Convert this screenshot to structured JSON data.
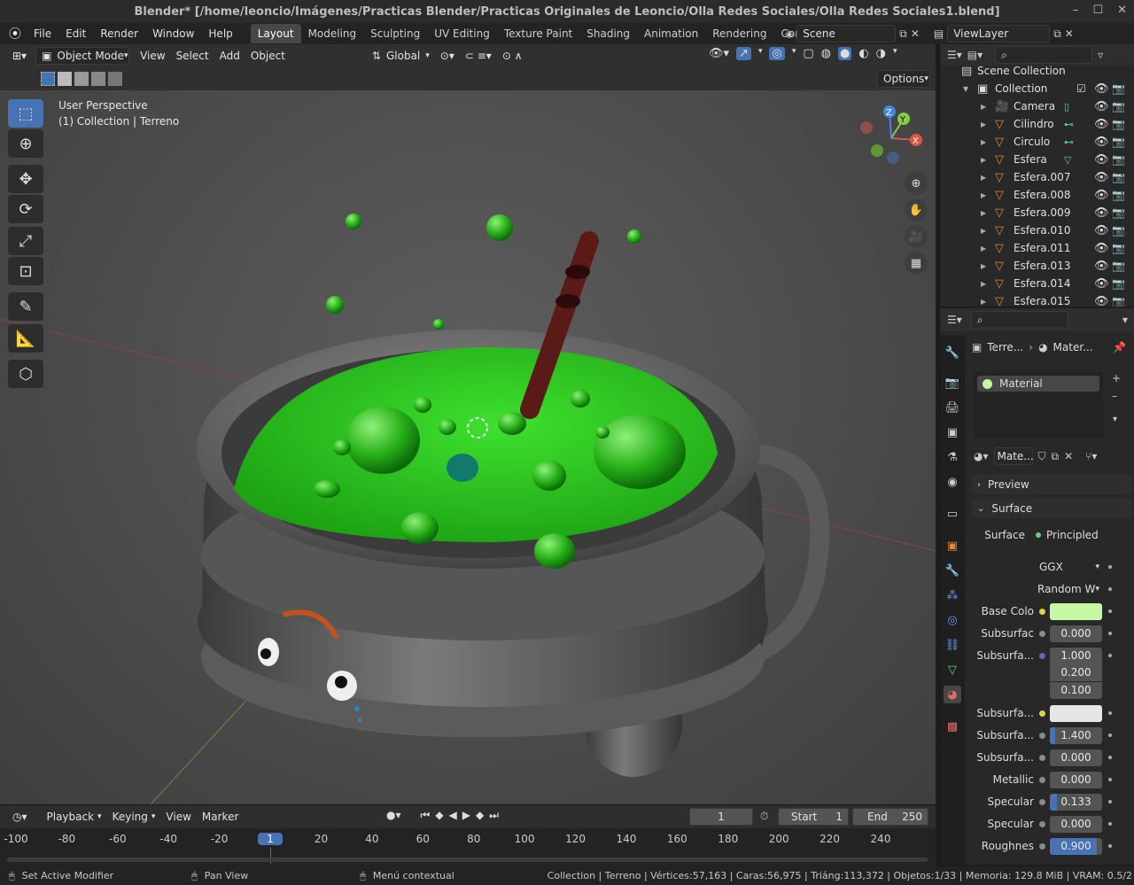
{
  "window": {
    "title": "Blender* [/home/leoncio/Imágenes/Practicas Blender/Practicas Originales de Leoncio/Olla Redes Sociales/Olla Redes Sociales1.blend]"
  },
  "menu": [
    "File",
    "Edit",
    "Render",
    "Window",
    "Help"
  ],
  "workspaces": [
    "Layout",
    "Modeling",
    "Sculpting",
    "UV Editing",
    "Texture Paint",
    "Shading",
    "Animation",
    "Rendering",
    "Compositing"
  ],
  "scene": "Scene",
  "viewlayer": "ViewLayer",
  "header3d": {
    "mode": "Object Mode",
    "view": "View",
    "select": "Select",
    "add": "Add",
    "object": "Object",
    "orientation": "Global",
    "options": "Options"
  },
  "viewport": {
    "perspective": "User Perspective",
    "collection_info": "(1) Collection | Terreno"
  },
  "outliner": {
    "root": "Scene Collection",
    "collection": "Collection",
    "items": [
      "Camera",
      "Cilindro",
      "Circulo",
      "Esfera",
      "Esfera.007",
      "Esfera.008",
      "Esfera.009",
      "Esfera.010",
      "Esfera.011",
      "Esfera.013",
      "Esfera.014",
      "Esfera.015"
    ]
  },
  "properties": {
    "breadcrumb_obj": "Terre...",
    "breadcrumb_mat": "Mater...",
    "material_slot": "Material",
    "material_name": "Mate...",
    "preview": "Preview",
    "surface_panel": "Surface",
    "surface_label": "Surface",
    "surface_value": "Principled",
    "distribution": "GGX",
    "sss_method": "Random W",
    "base_color_label": "Base Colo",
    "base_color": "#c6f7a2",
    "rows": [
      {
        "label": "Subsurfac",
        "value": "0.000",
        "fill": 0
      },
      {
        "label": "Subsurfa...",
        "value": "1.000",
        "fill": 0
      },
      {
        "label": "",
        "value": "0.200",
        "fill": 0
      },
      {
        "label": "",
        "value": "0.100",
        "fill": 0
      }
    ],
    "sss_color_label": "Subsurfa...",
    "rows2": [
      {
        "label": "Subsurfa...",
        "value": "1.400",
        "fill": 0.1
      },
      {
        "label": "Subsurfa...",
        "value": "0.000",
        "fill": 0
      },
      {
        "label": "Metallic",
        "value": "0.000",
        "fill": 0
      },
      {
        "label": "Specular",
        "value": "0.133",
        "fill": 0.133
      },
      {
        "label": "Specular",
        "value": "0.000",
        "fill": 0
      },
      {
        "label": "Roughnes",
        "value": "0.900",
        "fill": 0.9
      }
    ]
  },
  "timeline": {
    "playback": "Playback",
    "keying": "Keying",
    "view": "View",
    "marker": "Marker",
    "current_frame": "1",
    "start_label": "Start",
    "start": "1",
    "end_label": "End",
    "end": "250",
    "ticks": [
      "-100",
      "-80",
      "-60",
      "-40",
      "-20",
      "1",
      "20",
      "40",
      "60",
      "80",
      "100",
      "120",
      "140",
      "160",
      "180",
      "200",
      "220",
      "240"
    ]
  },
  "status": {
    "left1": "Set Active Modifier",
    "left2": "Pan View",
    "left3": "Menú contextual",
    "right": "Collection | Terreno | Vértices:57,163 | Caras:56,975 | Triáng:113,372 | Objetos:1/33 | Memoria: 129.8 MiB | VRAM: 0.5/2"
  }
}
